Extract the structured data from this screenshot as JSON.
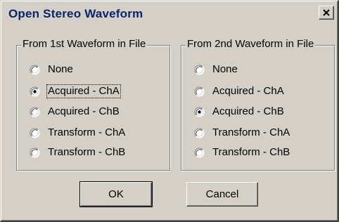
{
  "window": {
    "title": "Open Stereo Waveform",
    "close_icon": "close-x-icon"
  },
  "group1": {
    "legend": "From 1st Waveform in File",
    "options": [
      {
        "label": "None",
        "selected": false
      },
      {
        "label": "Acquired - ChA",
        "selected": true
      },
      {
        "label": "Acquired - ChB",
        "selected": false
      },
      {
        "label": "Transform - ChA",
        "selected": false
      },
      {
        "label": "Transform - ChB",
        "selected": false
      }
    ]
  },
  "group2": {
    "legend": "From 2nd Waveform in File",
    "options": [
      {
        "label": "None",
        "selected": false
      },
      {
        "label": "Acquired - ChA",
        "selected": false
      },
      {
        "label": "Acquired - ChB",
        "selected": true
      },
      {
        "label": "Transform - ChA",
        "selected": false
      },
      {
        "label": "Transform - ChB",
        "selected": false
      }
    ]
  },
  "buttons": {
    "ok_label": "OK",
    "cancel_label": "Cancel"
  },
  "colors": {
    "face": "#d4d0c8",
    "title_text": "#0a246a",
    "shadow": "#808080",
    "dark_shadow": "#404040",
    "highlight": "#ffffff"
  }
}
